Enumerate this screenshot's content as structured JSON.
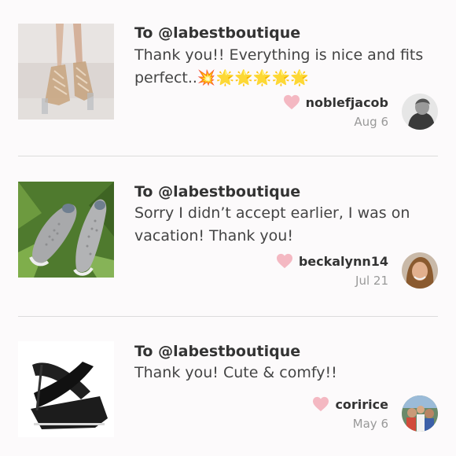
{
  "reviews": [
    {
      "to": "To @labestboutique",
      "message": "Thank you!! Everything is nice and fits perfect..💥🌟🌟🌟🌟🌟",
      "username": "noblefjacob",
      "date": "Aug 6",
      "product": "clear lace-up heels",
      "avatar": "user-photo"
    },
    {
      "to": "To @labestboutique",
      "message": "Sorry I didn’t accept earlier, I was on vacation! Thank you!",
      "username": "beckalynn14",
      "date": "Jul 21",
      "product": "silver perforated slip-on sneakers",
      "avatar": "user-photo"
    },
    {
      "to": "To @labestboutique",
      "message": "Thank you! Cute & comfy!!",
      "username": "coririce",
      "date": "May 6",
      "product": "black criss-cross wedge sandals",
      "avatar": "user-photo"
    }
  ],
  "colors": {
    "background": "#fcfafb",
    "heart": "#f4b8c2",
    "divider": "#dcdcdc",
    "date": "#999999"
  }
}
